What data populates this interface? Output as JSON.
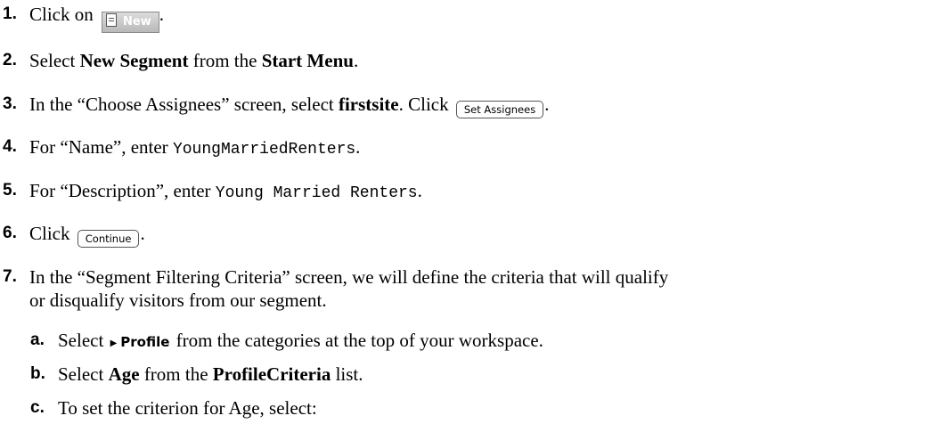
{
  "steps": [
    {
      "num": "1.",
      "pre": "Click on ",
      "button": "New",
      "post": "."
    },
    {
      "num": "2.",
      "pre": "Select ",
      "b1": "New Segment",
      "mid": " from the ",
      "b2": "Start Menu",
      "post": "."
    },
    {
      "num": "3.",
      "pre": "In the “Choose Assignees” screen, select ",
      "b1": "firstsite",
      "mid": ". Click ",
      "button": "Set Assignees",
      "post": "."
    },
    {
      "num": "4.",
      "pre": "For “Name”, enter ",
      "code": "YoungMarriedRenters",
      "post": "."
    },
    {
      "num": "5.",
      "pre": "For “Description”, enter ",
      "code": "Young Married Renters",
      "post": "."
    },
    {
      "num": "6.",
      "pre": "Click ",
      "button": "Continue",
      "post": "."
    },
    {
      "num": "7.",
      "line1": "In the “Segment Filtering Criteria” screen, we will define the criteria that will qualify",
      "line2": "or disqualify visitors from our segment."
    }
  ],
  "substeps": [
    {
      "num": "a.",
      "pre": "Select ",
      "category": "Profile",
      "post": " from the categories at the top of your workspace."
    },
    {
      "num": "b.",
      "pre": "Select ",
      "b1": "Age",
      "mid": " from the ",
      "b2": "ProfileCriteria",
      "post": " list."
    },
    {
      "num": "c.",
      "pre": "To set the criterion for Age, select:"
    }
  ]
}
